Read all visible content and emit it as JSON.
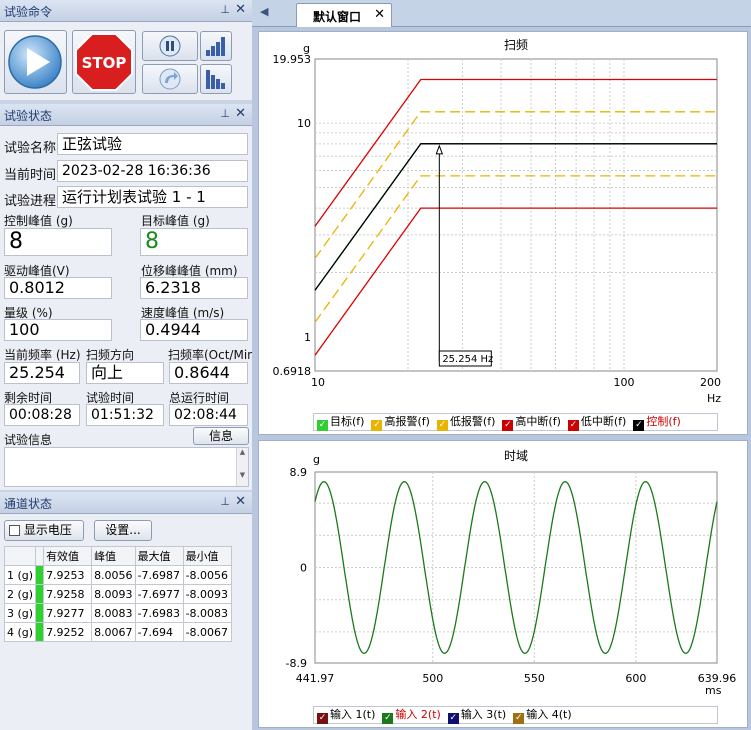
{
  "panels": {
    "command": "试验命令",
    "status": "试验状态",
    "channel": "通道状态"
  },
  "command": {
    "stop_label": "STOP"
  },
  "status": {
    "name_label": "试验名称",
    "name_value": "正弦试验",
    "time_label": "当前时间",
    "time_value": "2023-02-28 16:36:36",
    "progress_label": "试验进程",
    "progress_value": "运行计划表试验 1 - 1",
    "ctrl_peak_label": "控制峰值 (g)",
    "ctrl_peak_value": "8",
    "target_peak_label": "目标峰值 (g)",
    "target_peak_value": "8",
    "drive_peak_label": "驱动峰值(V)",
    "drive_peak_value": "0.8012",
    "disp_peak_label": "位移峰峰值 (mm)",
    "disp_peak_value": "6.2318",
    "level_label": "量级 (%)",
    "level_value": "100",
    "vel_peak_label": "速度峰值 (m/s)",
    "vel_peak_value": "0.4944",
    "freq_label": "当前频率 (Hz)",
    "freq_value": "25.254",
    "dir_label": "扫频方向",
    "dir_value": "向上",
    "rate_label": "扫频率(Oct/Min)",
    "rate_value": "0.8644",
    "remain_label": "剩余时间",
    "remain_value": "00:08:28",
    "test_time_label": "试验时间",
    "test_time_value": "01:51:32",
    "total_label": "总运行时间",
    "total_value": "02:08:44",
    "info_label": "试验信息",
    "info_button": "信息"
  },
  "channel": {
    "show_voltage": "显示电压",
    "settings": "设置...",
    "headers": [
      "有效值",
      "峰值",
      "最大值",
      "最小值"
    ],
    "rows": [
      {
        "name": "1 (g)",
        "rms": "7.9253",
        "peak": "8.0056",
        "max": "-7.6987",
        "min": "-8.0056"
      },
      {
        "name": "2 (g)",
        "rms": "7.9258",
        "peak": "8.0093",
        "max": "-7.6977",
        "min": "-8.0093"
      },
      {
        "name": "3 (g)",
        "rms": "7.9277",
        "peak": "8.0083",
        "max": "-7.6983",
        "min": "-8.0083"
      },
      {
        "name": "4 (g)",
        "rms": "7.9252",
        "peak": "8.0067",
        "max": "-7.694",
        "min": "-8.0067"
      }
    ]
  },
  "tab": {
    "label": "默认窗口"
  },
  "chart_data": [
    {
      "type": "line",
      "title": "扫频",
      "ylabel": "g",
      "xlabel": "Hz",
      "xscale": "log",
      "yscale": "log",
      "xlim": [
        10,
        200
      ],
      "ylim": [
        0.6918,
        19.953
      ],
      "xticks": [
        "10",
        "100",
        "200"
      ],
      "yticks": [
        "19.953",
        "10",
        "1",
        "0.6918"
      ],
      "grid": true,
      "cursor_label": "25.254 Hz",
      "cursor_x": 25.254,
      "knee_x": 22,
      "series": [
        {
          "name": "目标(f)",
          "color": "#00aa00",
          "x": [
            10,
            22,
            200
          ],
          "y": [
            1.65,
            8,
            8
          ]
        },
        {
          "name": "高报警(f)",
          "color": "#e8b400",
          "dash": true,
          "x": [
            10,
            22,
            200
          ],
          "y": [
            2.33,
            11.3,
            11.3
          ]
        },
        {
          "name": "低报警(f)",
          "color": "#e8b400",
          "dash": true,
          "x": [
            10,
            22,
            200
          ],
          "y": [
            1.17,
            5.66,
            5.66
          ]
        },
        {
          "name": "高中断(f)",
          "color": "#dd0000",
          "x": [
            10,
            22,
            200
          ],
          "y": [
            3.29,
            16,
            16
          ]
        },
        {
          "name": "低中断(f)",
          "color": "#dd0000",
          "x": [
            10,
            22,
            200
          ],
          "y": [
            0.82,
            4,
            4
          ]
        },
        {
          "name": "控制(f)",
          "color": "#000000",
          "x": [
            10,
            22,
            25.254
          ],
          "y": [
            1.65,
            8,
            8
          ]
        }
      ],
      "legend": [
        {
          "label": "目标(f)",
          "color": "#33cc33"
        },
        {
          "label": "高报警(f)",
          "color": "#e8b400"
        },
        {
          "label": "低报警(f)",
          "color": "#e8b400"
        },
        {
          "label": "高中断(f)",
          "color": "#cc0000"
        },
        {
          "label": "低中断(f)",
          "color": "#cc0000"
        },
        {
          "label": "控制(f)",
          "color": "#000000",
          "text_color": "#cc0000"
        }
      ]
    },
    {
      "type": "line",
      "title": "时域",
      "ylabel": "g",
      "xlabel": "ms",
      "xlim": [
        441.97,
        639.96
      ],
      "ylim": [
        -8.9,
        8.9
      ],
      "xticks": [
        "441.97",
        "500",
        "550",
        "600",
        "639.96"
      ],
      "yticks": [
        "8.9",
        "0",
        "-8.9"
      ],
      "grid": true,
      "series": [
        {
          "name": "输入 1(t)",
          "color": "#1a7a1a",
          "amplitude": 8.0,
          "frequency_hz": 25.254,
          "phase_deg": 50
        }
      ],
      "legend": [
        {
          "label": "输入 1(t)",
          "color": "#7a1010"
        },
        {
          "label": "输入 2(t)",
          "color": "#1a7a1a",
          "text_color": "#cc0000"
        },
        {
          "label": "输入 3(t)",
          "color": "#101070"
        },
        {
          "label": "输入 4(t)",
          "color": "#a07010"
        }
      ]
    }
  ]
}
